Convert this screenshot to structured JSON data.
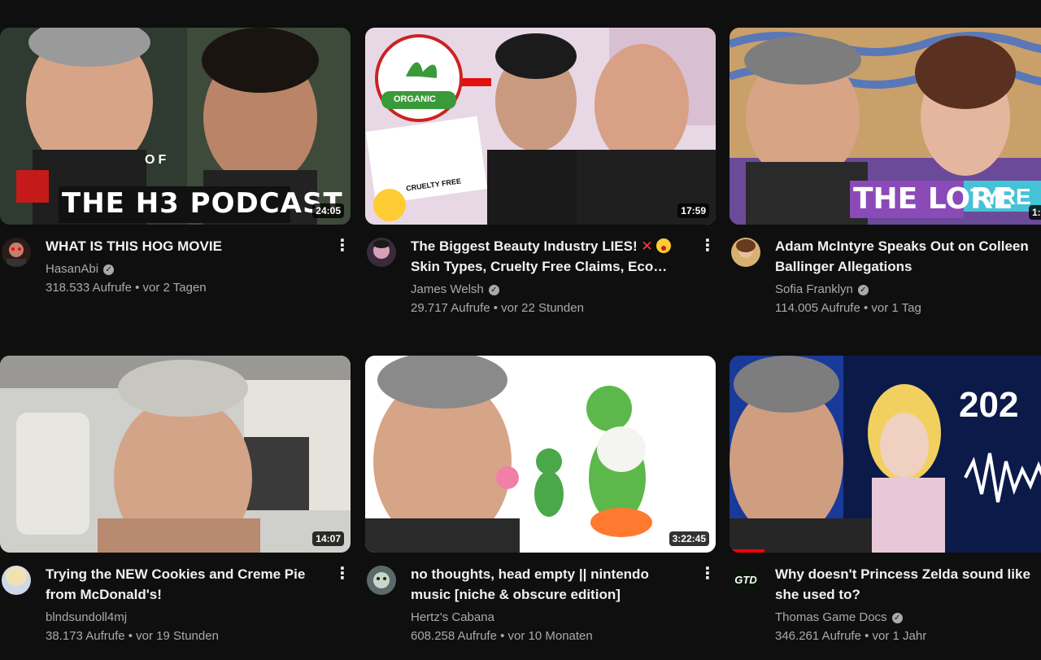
{
  "videos": [
    {
      "title": "WHAT IS THIS HOG MOVIE",
      "channel": "HasanAbi",
      "verified": true,
      "stats": "318.533 Aufrufe • vor 2 Tagen",
      "duration": "24:05",
      "thumb_text": "THE H3 PODCAST",
      "thumb_text_2": "OF"
    },
    {
      "title": "The Biggest Beauty Industry LIES!",
      "title_emoji_x": "✕",
      "title_line2": "Skin Types, Cruelty Free Claims, Eco…",
      "channel": "James Welsh",
      "verified": true,
      "stats": "29.717 Aufrufe • vor 22 Stunden",
      "duration": "17:59",
      "badge_organic": "ORGANIC",
      "badge_cruelty": "CRUELTY FREE"
    },
    {
      "title": "Adam McIntyre Speaks Out on Colleen Ballinger Allegations",
      "channel": "Sofia Franklyn",
      "verified": true,
      "stats": "114.005 Aufrufe • vor 1 Tag",
      "duration": "1:",
      "thumb_text": "THE LORE",
      "thumb_text_2": "TYRE"
    },
    {
      "title": "Trying the NEW Cookies and Creme Pie from McDonald's!",
      "channel": "blndsundoll4mj",
      "verified": false,
      "stats": "38.173 Aufrufe • vor 19 Stunden",
      "duration": "14:07"
    },
    {
      "title": "no thoughts, head empty || nintendo music [niche & obscure edition]",
      "channel": "Hertz's Cabana",
      "verified": false,
      "stats": "608.258 Aufrufe • vor 10 Monaten",
      "duration": "3:22:45"
    },
    {
      "title": "Why doesn't Princess Zelda sound like she used to?",
      "channel": "Thomas Game Docs",
      "verified": true,
      "stats": "346.261 Aufrufe • vor 1 Jahr",
      "duration": "",
      "thumb_text": "202",
      "avatar_text": "GTD",
      "watched_fraction": 0.1
    }
  ],
  "colors": {
    "background": "#0f0f0f",
    "title": "#f1f1f1",
    "secondary": "#aaaaaa",
    "progress": "#ff0000"
  },
  "icons": {
    "more": "more-vert-icon",
    "verified": "verified-check-icon"
  }
}
